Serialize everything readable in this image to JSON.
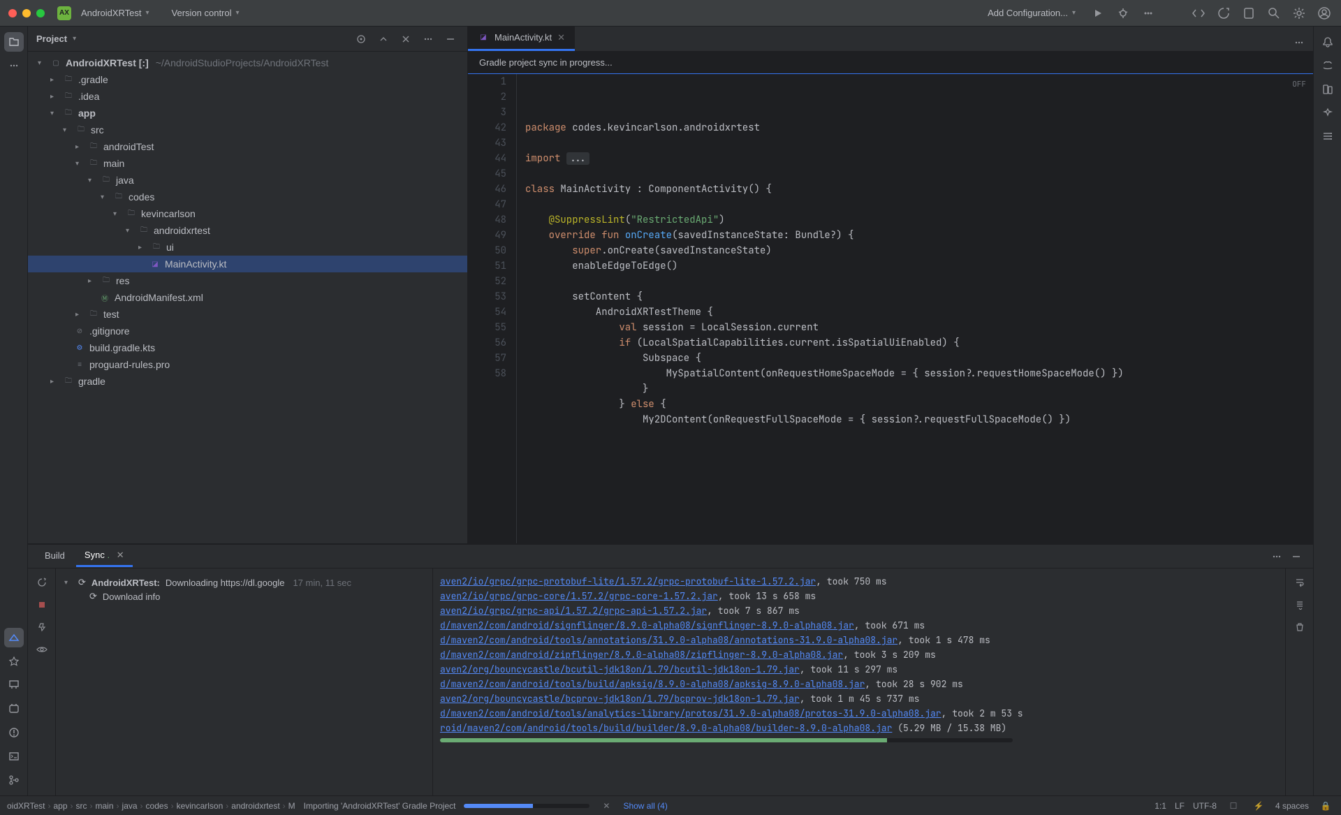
{
  "titlebar": {
    "app_badge": "AX",
    "project_name": "AndroidXRTest",
    "vcs_label": "Version control",
    "run_config": "Add Configuration..."
  },
  "project_header": {
    "title": "Project"
  },
  "project_tree": {
    "root_name": "AndroidXRTest [:]",
    "root_hint": "~/AndroidStudioProjects/AndroidXRTest",
    "nodes": [
      ".gradle",
      ".idea",
      "app",
      "src",
      "androidTest",
      "main",
      "java",
      "codes",
      "kevincarlson",
      "androidxrtest",
      "ui",
      "MainActivity.kt",
      "res",
      "AndroidManifest.xml",
      "test",
      ".gitignore",
      "build.gradle.kts",
      "proguard-rules.pro",
      "gradle"
    ]
  },
  "editor": {
    "tab_name": "MainActivity.kt",
    "banner": "Gradle project sync in progress...",
    "off_badge": "OFF",
    "line_numbers": [
      "1",
      "2",
      "3",
      "42",
      "43",
      "44",
      "45",
      "46",
      "47",
      "48",
      "49",
      "50",
      "51",
      "52",
      "53",
      "54",
      "55",
      "56",
      "57",
      "58"
    ],
    "code_lines": [
      {
        "n": 1,
        "html": "<span class='kw'>package</span> codes.kevincarlson.androidxrtest"
      },
      {
        "n": 2,
        "html": ""
      },
      {
        "n": 3,
        "html": "<span class='kw'>import</span> <span class='grey-box'>...</span>"
      },
      {
        "n": 42,
        "html": ""
      },
      {
        "n": 43,
        "html": "<span class='kw'>class</span> MainActivity : ComponentActivity() {"
      },
      {
        "n": 44,
        "html": ""
      },
      {
        "n": 45,
        "html": "    <span class='ann'>@SuppressLint</span>(<span class='str'>\"RestrictedApi\"</span>)"
      },
      {
        "n": 46,
        "html": "    <span class='kw'>override fun</span> <span class='fn'>onCreate</span>(savedInstanceState: Bundle?) {"
      },
      {
        "n": 47,
        "html": "        <span class='kw'>super</span>.onCreate(savedInstanceState)"
      },
      {
        "n": 48,
        "html": "        enableEdgeToEdge()"
      },
      {
        "n": 49,
        "html": ""
      },
      {
        "n": 50,
        "html": "        setContent {"
      },
      {
        "n": 51,
        "html": "            AndroidXRTestTheme {"
      },
      {
        "n": 52,
        "html": "                <span class='kw'>val</span> session = LocalSession.current"
      },
      {
        "n": 53,
        "html": "                <span class='kw'>if</span> (LocalSpatialCapabilities.current.isSpatialUiEnabled) {"
      },
      {
        "n": 54,
        "html": "                    Subspace {"
      },
      {
        "n": 55,
        "html": "                        MySpatialContent(onRequestHomeSpaceMode = { session?.requestHomeSpaceMode() })"
      },
      {
        "n": 56,
        "html": "                    }"
      },
      {
        "n": 57,
        "html": "                } <span class='kw'>else</span> {"
      },
      {
        "n": 58,
        "html": "                    My2DContent(onRequestFullSpaceMode = { session?.requestFullSpaceMode() })"
      }
    ]
  },
  "build": {
    "tab_build": "Build",
    "tab_sync": "Sync",
    "task_project": "AndroidXRTest:",
    "task_action": "Downloading https://dl.google",
    "task_time": "17 min, 11 sec",
    "subtask": "Download info",
    "downloads": [
      {
        "link": "aven2/io/grpc/grpc-protobuf-lite/1.57.2/grpc-protobuf-lite-1.57.2.jar",
        "tail": ", took 750 ms"
      },
      {
        "link": "aven2/io/grpc/grpc-core/1.57.2/grpc-core-1.57.2.jar",
        "tail": ", took 13 s 658 ms"
      },
      {
        "link": "aven2/io/grpc/grpc-api/1.57.2/grpc-api-1.57.2.jar",
        "tail": ", took 7 s 867 ms"
      },
      {
        "link": "d/maven2/com/android/signflinger/8.9.0-alpha08/signflinger-8.9.0-alpha08.jar",
        "tail": ", took 671 ms"
      },
      {
        "link": "d/maven2/com/android/tools/annotations/31.9.0-alpha08/annotations-31.9.0-alpha08.jar",
        "tail": ", took 1 s 478 ms"
      },
      {
        "link": "d/maven2/com/android/zipflinger/8.9.0-alpha08/zipflinger-8.9.0-alpha08.jar",
        "tail": ", took 3 s 209 ms"
      },
      {
        "link": "aven2/org/bouncycastle/bcutil-jdk18on/1.79/bcutil-jdk18on-1.79.jar",
        "tail": ", took 11 s 297 ms"
      },
      {
        "link": "d/maven2/com/android/tools/build/apksig/8.9.0-alpha08/apksig-8.9.0-alpha08.jar",
        "tail": ", took 28 s 902 ms"
      },
      {
        "link": "aven2/org/bouncycastle/bcprov-jdk18on/1.79/bcprov-jdk18on-1.79.jar",
        "tail": ", took 1 m 45 s 737 ms"
      },
      {
        "link": "d/maven2/com/android/tools/analytics-library/protos/31.9.0-alpha08/protos-31.9.0-alpha08.jar",
        "tail": ", took 2 m 53 s"
      },
      {
        "link": "roid/maven2/com/android/tools/build/builder/8.9.0-alpha08/builder-8.9.0-alpha08.jar",
        "tail": " (5.29 MB / 15.38 MB)"
      }
    ]
  },
  "status": {
    "breadcrumbs": [
      "oidXRTest",
      "app",
      "src",
      "main",
      "java",
      "codes",
      "kevincarlson",
      "androidxrtest",
      "M"
    ],
    "import_label": "Importing 'AndroidXRTest' Gradle Project",
    "show_all": "Show all (4)",
    "pos": "1:1",
    "line_sep": "LF",
    "encoding": "UTF-8",
    "indent": "4 spaces"
  }
}
